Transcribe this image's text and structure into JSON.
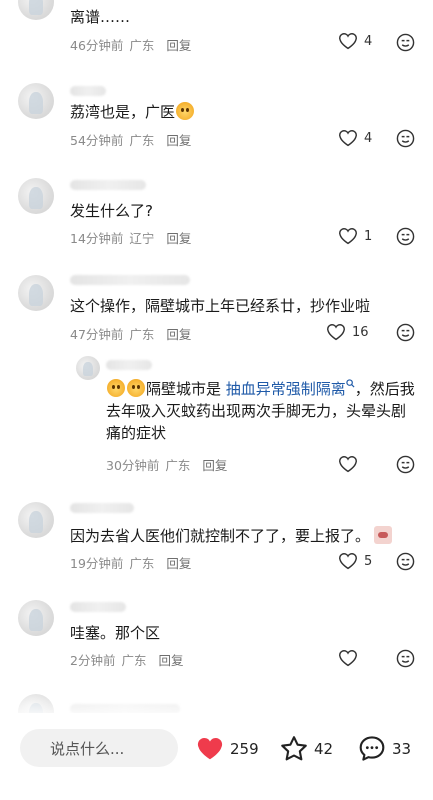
{
  "comments": [
    {
      "text": "离谱……",
      "time": "46分钟前",
      "location": "广东",
      "reply": "回复",
      "likes": "4"
    },
    {
      "text_prefix": "荔湾也是，广医",
      "time": "54分钟前",
      "location": "广东",
      "reply": "回复",
      "likes": "4"
    },
    {
      "text": "发生什么了?",
      "time": "14分钟前",
      "location": "辽宁",
      "reply": "回复",
      "likes": "1"
    },
    {
      "text": "这个操作，隔壁城市上年已经系廿，抄作业啦",
      "time": "47分钟前",
      "location": "广东",
      "reply": "回复",
      "likes": "16"
    },
    {
      "reply_prefix": "隔壁城市是 ",
      "reply_link": "抽血异常强制隔离",
      "reply_rest": "，然后我去年吸入灭蚊药出现两次手脚无力，头晕头剧痛的症状",
      "time": "30分钟前",
      "location": "广东",
      "reply": "回复",
      "likes": ""
    },
    {
      "text": "因为去省人医他们就控制不了了，要上报了。",
      "time": "19分钟前",
      "location": "广东",
      "reply": "回复",
      "likes": "5"
    },
    {
      "text": "哇塞。那个区",
      "time": "2分钟前",
      "location": "广东",
      "reply": "回复",
      "likes": ""
    }
  ],
  "bottom_bar": {
    "input_placeholder": "说点什么...",
    "like_count": "259",
    "star_count": "42",
    "comment_count": "33"
  },
  "colors": {
    "heart": "#ef3b4c",
    "link": "#1f5aa8"
  }
}
